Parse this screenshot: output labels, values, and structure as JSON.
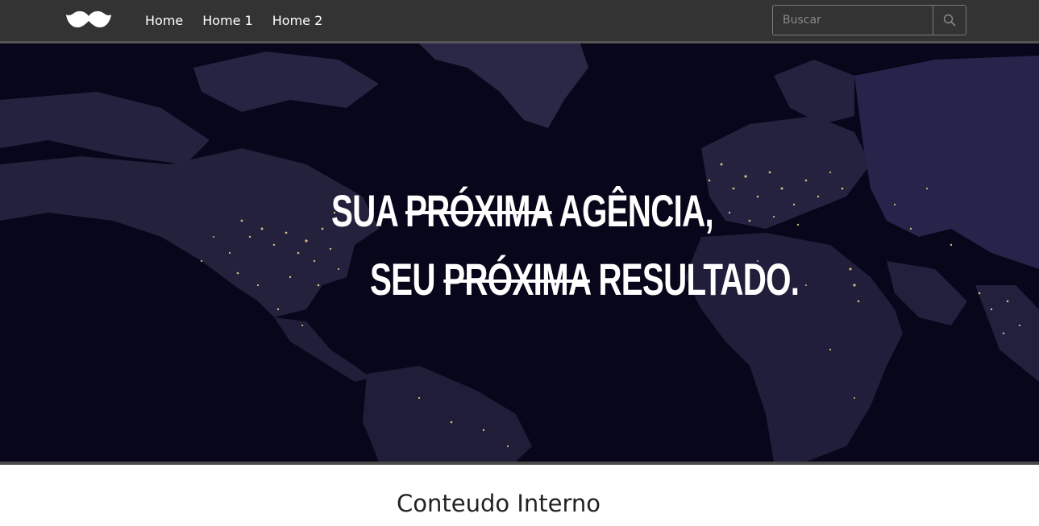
{
  "nav": {
    "links": [
      "Home",
      "Home 1",
      "Home 2"
    ],
    "search_placeholder": "Buscar"
  },
  "hero": {
    "line1": {
      "before": "SUA",
      "struck": "PRÓXIMA",
      "after": "AGÊNCIA,"
    },
    "line2": {
      "before": "SEU",
      "struck": "PRÓXIMA",
      "after": "RESULTADO."
    }
  },
  "content": {
    "title": "Conteudo Interno"
  },
  "colors": {
    "navbar": "#333333",
    "hero_bg": "#07061a",
    "land": "#2a2846",
    "city_lights": "#f5d98a"
  }
}
